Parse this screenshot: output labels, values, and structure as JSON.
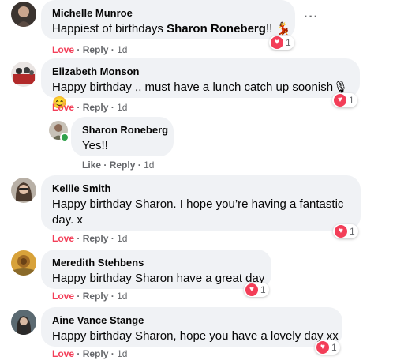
{
  "comments": [
    {
      "name": "Michelle Munroe",
      "text_before": "Happiest of birthdays ",
      "text_bold": "Sharon Roneberg",
      "text_after": "!! ",
      "emoji": "💃",
      "reaction_count": "1",
      "love": "Love",
      "reply": "Reply",
      "time": "1d"
    },
    {
      "name": "Elizabeth Monson",
      "text": "Happy birthday ,, must have a lunch catch up soonish",
      "emoji": "🎙😊",
      "reaction_count": "1",
      "love": "Love",
      "reply": "Reply",
      "time": "1d"
    },
    {
      "name": "Sharon Roneberg",
      "text": "Yes!!",
      "like": "Like",
      "reply": "Reply",
      "time": "1d"
    },
    {
      "name": "Kellie Smith",
      "text": "Happy birthday Sharon. I hope you’re having a fantastic day. x",
      "reaction_count": "1",
      "love": "Love",
      "reply": "Reply",
      "time": "1d"
    },
    {
      "name": "Meredith Stehbens",
      "text": "Happy birthday Sharon have a great day",
      "reaction_count": "1",
      "love": "Love",
      "reply": "Reply",
      "time": "1d"
    },
    {
      "name": "Aine Vance Stange",
      "text": "Happy birthday Sharon, hope you have a lovely day xx",
      "reaction_count": "1",
      "love": "Love",
      "reply": "Reply",
      "time": "1d"
    }
  ],
  "separator": "·",
  "more_icon": "more-horizontal-icon",
  "reaction_icon": "heart-icon",
  "colors": {
    "love": "#f33e58",
    "bubble": "#f0f2f5",
    "meta": "#65676b",
    "online": "#31a24c"
  }
}
